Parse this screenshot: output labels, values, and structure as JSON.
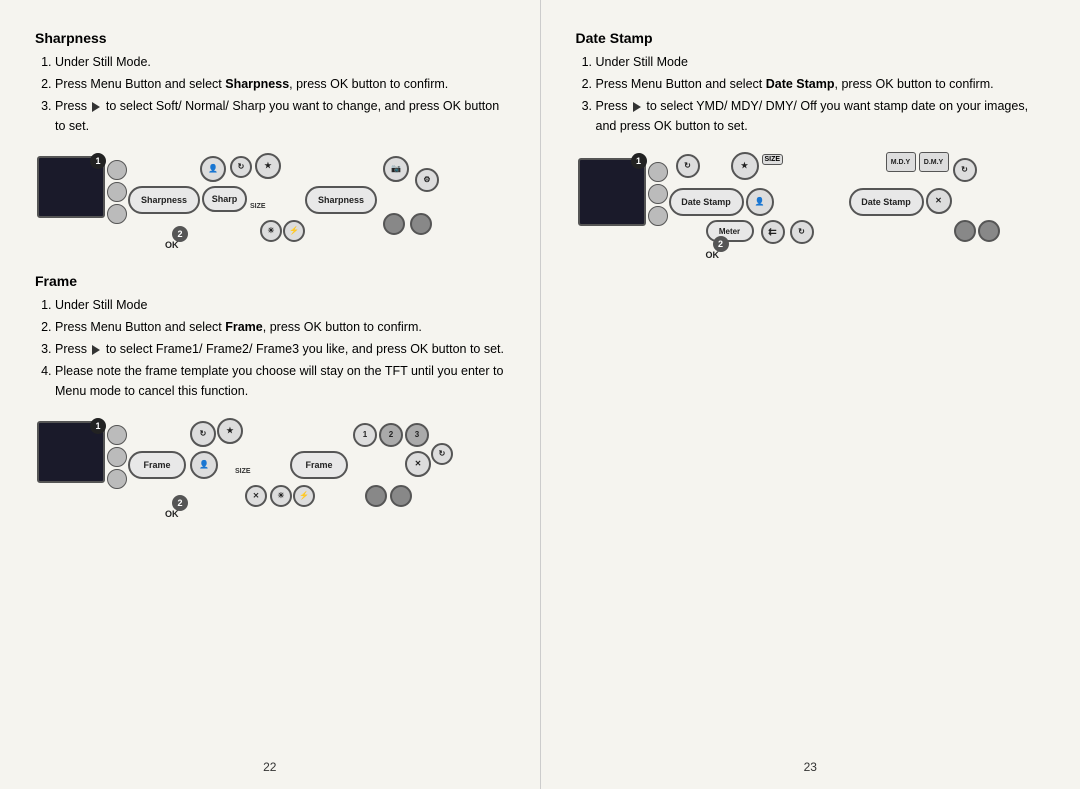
{
  "left_page": {
    "number": "22",
    "sharpness": {
      "title": "Sharpness",
      "steps": [
        "Under Still Mode.",
        "Press Menu Button and select {bold}Sharpness{/bold}, press OK button to confirm.",
        "Press {arrow} to select Soft/ Normal/ Sharp you want to change, and press OK button to set."
      ]
    },
    "frame": {
      "title": "Frame",
      "steps": [
        "Under Still Mode",
        "Press Menu Button and select {bold}Frame{/bold}, press OK button to confirm.",
        "Press {arrow} to select Frame1/ Frame2/ Frame3 you like, and press OK button to set.",
        "Please note the frame template you choose will stay on the TFT until you enter to Menu mode to cancel this function."
      ]
    }
  },
  "right_page": {
    "number": "23",
    "date_stamp": {
      "title": "Date Stamp",
      "steps": [
        "Under Still Mode",
        "Press Menu Button and select {bold}Date Stamp{/bold}, press OK button to confirm.",
        "Press {arrow} to select YMD/ MDY/ DMY/ Off you want stamp date on your images, and press OK button to set."
      ]
    }
  }
}
